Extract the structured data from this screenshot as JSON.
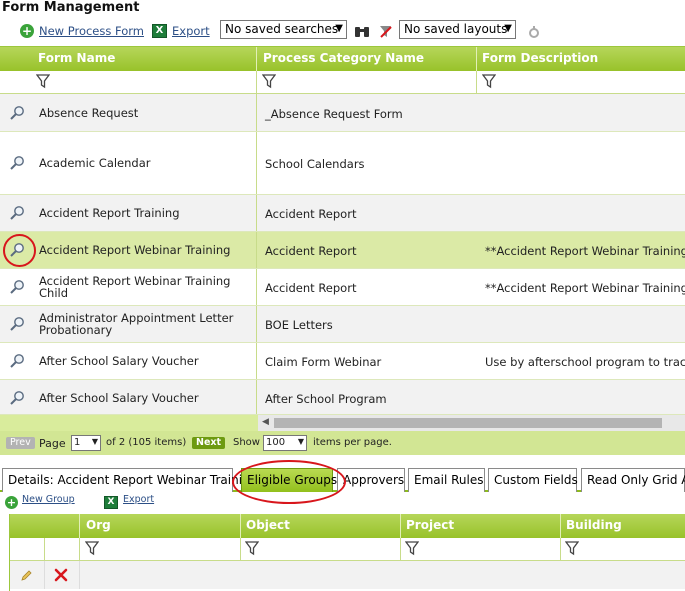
{
  "page_title": "Form Management",
  "toolbar": {
    "new_label": "New Process Form",
    "export_label": "Export",
    "searches_value": "No saved searches",
    "layouts_value": "No saved layouts"
  },
  "grid": {
    "columns": [
      "Form Name",
      "Process Category Name",
      "Form Description"
    ],
    "rows": [
      {
        "name": "Absence Request",
        "category": "_Absence Request Form",
        "description": ""
      },
      {
        "name": "Academic Calendar",
        "category": "School Calendars",
        "description": ""
      },
      {
        "name": "Accident Report Training",
        "category": "Accident Report",
        "description": ""
      },
      {
        "name": "Accident Report Webinar Training",
        "category": "Accident Report",
        "description": "**Accident Report Webinar Training"
      },
      {
        "name": "Accident Report Webinar Training Child",
        "category": "Accident Report",
        "description": "**Accident Report Webinar Training"
      },
      {
        "name": "Administrator Appointment Letter Probationary",
        "category": "BOE Letters",
        "description": ""
      },
      {
        "name": "After School Salary Voucher",
        "category": "Claim Form Webinar",
        "description": "Use by afterschool program to track"
      },
      {
        "name": "After School Salary Voucher",
        "category": "After School Program",
        "description": ""
      }
    ]
  },
  "pager": {
    "prev": "Prev",
    "page_label": "Page",
    "page_value": "1",
    "of_text": "of 2 (105 items)",
    "next": "Next",
    "show_label": "Show",
    "show_value": "100",
    "per_page": "items per page."
  },
  "tabs": [
    "Details: Accident Report Webinar Training",
    "Eligible Groups",
    "Approvers",
    "Email Rules",
    "Custom Fields",
    "Read Only Grid Ac"
  ],
  "active_tab": "Eligible Groups",
  "sub_toolbar": {
    "new_label": "New Group",
    "export_label": "Export"
  },
  "grid2": {
    "columns": [
      "Org",
      "Object",
      "Project",
      "Building"
    ]
  },
  "colors": {
    "header_green": "#98c22a",
    "selected_row": "#dbeaa6",
    "annotation_red": "#d8161c",
    "link_blue": "#2c4f86"
  }
}
